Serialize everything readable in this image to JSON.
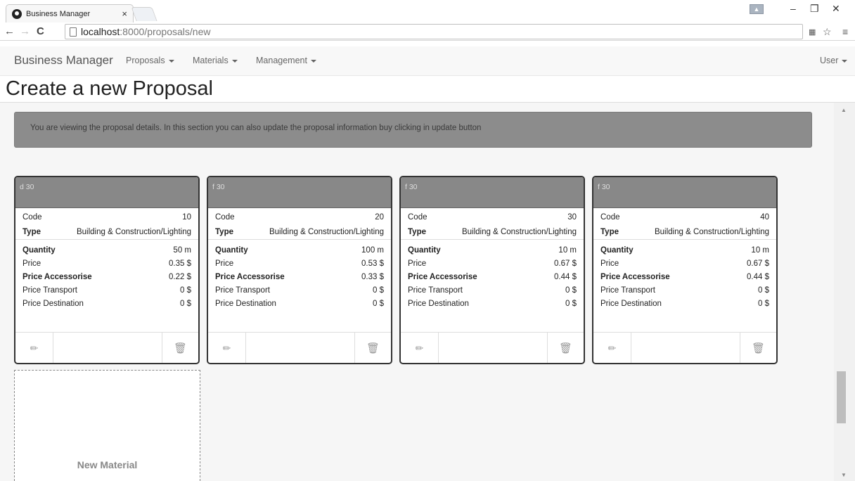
{
  "browser": {
    "tab_title": "Business Manager",
    "tab_close": "×",
    "url_host": "localhost",
    "url_path": ":8000/proposals/new",
    "win_minimize": "–",
    "win_restore": "❐",
    "win_close": "✕"
  },
  "navbar": {
    "brand": "Business Manager",
    "items": [
      {
        "label": "Proposals"
      },
      {
        "label": "Materials"
      },
      {
        "label": "Management"
      }
    ],
    "user": "User"
  },
  "page": {
    "title": "Create a new Proposal",
    "info": "You are viewing the proposal details. In this section you can also update the proposal information buy clicking in update button"
  },
  "field_labels": {
    "code": "Code",
    "type": "Type",
    "quantity": "Quantity",
    "price": "Price",
    "price_accessorise": "Price Accessorise",
    "price_transport": "Price Transport",
    "price_destination": "Price Destination"
  },
  "cards": [
    {
      "header": "d 30",
      "code": "10",
      "type": "Building & Construction/Lighting",
      "quantity": "50 m",
      "price": "0.35 $",
      "price_accessorise": "0.22 $",
      "price_transport": "0 $",
      "price_destination": "0 $"
    },
    {
      "header": "f 30",
      "code": "20",
      "type": "Building & Construction/Lighting",
      "quantity": "100 m",
      "price": "0.53 $",
      "price_accessorise": "0.33 $",
      "price_transport": "0 $",
      "price_destination": "0 $"
    },
    {
      "header": "f 30",
      "code": "30",
      "type": "Building & Construction/Lighting",
      "quantity": "10 m",
      "price": "0.67 $",
      "price_accessorise": "0.44 $",
      "price_transport": "0 $",
      "price_destination": "0 $"
    },
    {
      "header": "f 30",
      "code": "40",
      "type": "Building & Construction/Lighting",
      "quantity": "10 m",
      "price": "0.67 $",
      "price_accessorise": "0.44 $",
      "price_transport": "0 $",
      "price_destination": "0 $"
    }
  ],
  "new_material_label": "New Material",
  "icons": {
    "edit": "pencil-icon",
    "delete": "trash-icon"
  }
}
